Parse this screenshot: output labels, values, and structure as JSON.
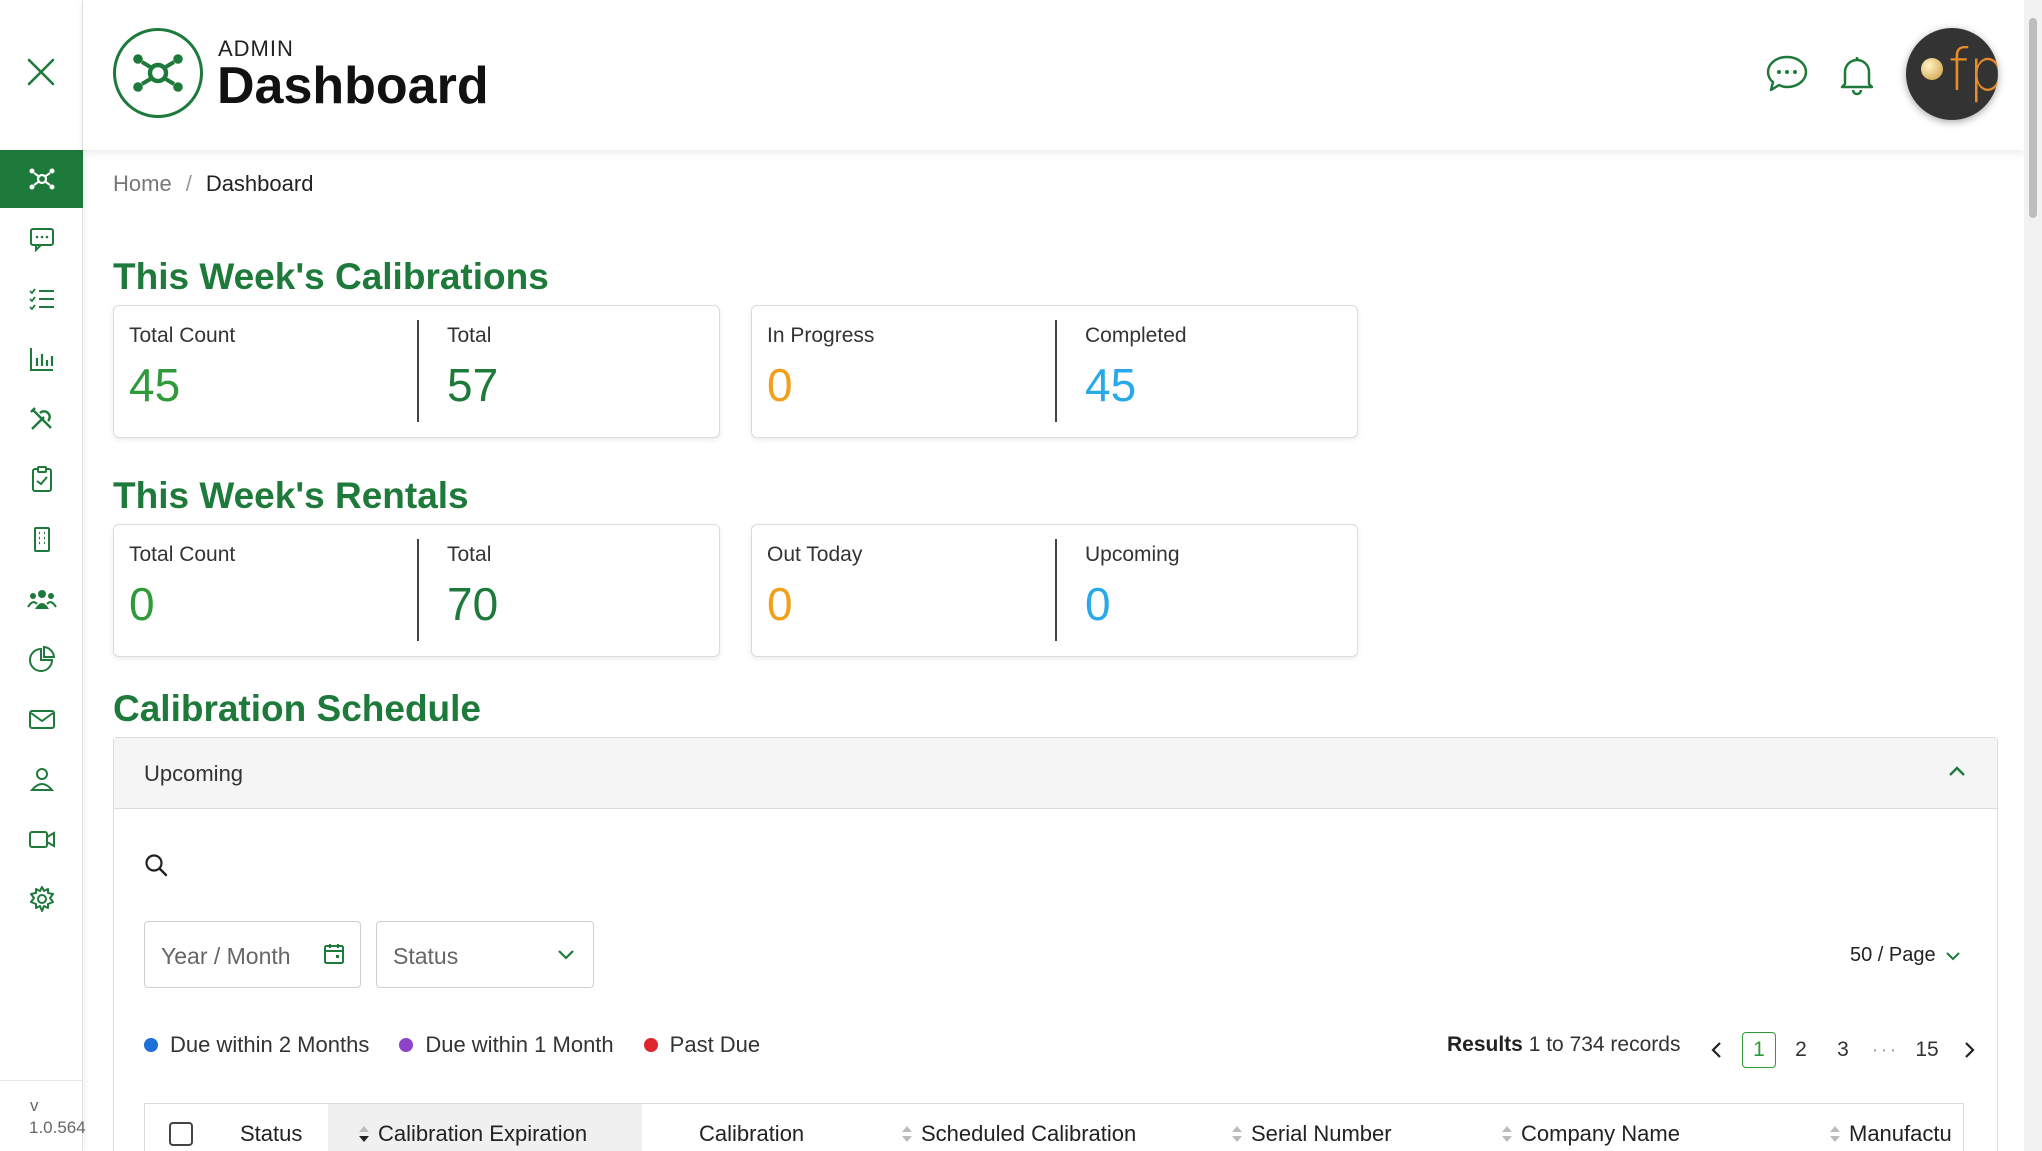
{
  "sidebar": {
    "items": [
      {
        "name": "sidebar-item-dashboard",
        "icon": "network-icon",
        "active": true
      },
      {
        "name": "sidebar-item-messages",
        "icon": "chat-icon"
      },
      {
        "name": "sidebar-item-tasks",
        "icon": "checklist-icon"
      },
      {
        "name": "sidebar-item-reports",
        "icon": "bar-chart-icon"
      },
      {
        "name": "sidebar-item-tools",
        "icon": "tools-icon"
      },
      {
        "name": "sidebar-item-clipboard",
        "icon": "clipboard-check-icon"
      },
      {
        "name": "sidebar-item-building",
        "icon": "building-icon"
      },
      {
        "name": "sidebar-item-users",
        "icon": "users-icon"
      },
      {
        "name": "sidebar-item-analytics",
        "icon": "pie-chart-icon"
      },
      {
        "name": "sidebar-item-mail",
        "icon": "mail-icon"
      },
      {
        "name": "sidebar-item-profile",
        "icon": "user-pin-icon"
      },
      {
        "name": "sidebar-item-video",
        "icon": "video-icon"
      },
      {
        "name": "sidebar-item-settings",
        "icon": "gear-icon"
      }
    ],
    "version_prefix": "v",
    "version": "1.0.564"
  },
  "header": {
    "admin_label": "ADMIN",
    "title": "Dashboard",
    "avatar_text": "fp"
  },
  "breadcrumb": {
    "home": "Home",
    "separator": "/",
    "current": "Dashboard"
  },
  "calibrations": {
    "title": "This Week's Calibrations",
    "card1": {
      "label1": "Total Count",
      "value1": "45",
      "label2": "Total",
      "value2": "57"
    },
    "card2": {
      "label1": "In Progress",
      "value1": "0",
      "label2": "Completed",
      "value2": "45"
    }
  },
  "rentals": {
    "title": "This Week's Rentals",
    "card1": {
      "label1": "Total Count",
      "value1": "0",
      "label2": "Total",
      "value2": "70"
    },
    "card2": {
      "label1": "Out Today",
      "value1": "0",
      "label2": "Upcoming",
      "value2": "0"
    }
  },
  "schedule": {
    "title": "Calibration Schedule",
    "panel_title": "Upcoming",
    "date_placeholder": "Year / Month",
    "status_placeholder": "Status",
    "per_page": "50 / Page",
    "legend": [
      {
        "label": "Due within 2 Months",
        "color": "#1e6fd9"
      },
      {
        "label": "Due within 1 Month",
        "color": "#8e44c9"
      },
      {
        "label": "Past Due",
        "color": "#e0242b"
      }
    ],
    "results_bold": "Results",
    "results_text": "1 to 734 records",
    "pages": [
      "1",
      "2",
      "3",
      "···",
      "15"
    ],
    "columns": [
      "Status",
      "Calibration Expiration",
      "Calibration",
      "Scheduled Calibration",
      "Serial Number",
      "Company Name",
      "Manufactu"
    ]
  },
  "colors": {
    "brand_green": "#1e7a3a",
    "value_green": "#2e9a3a",
    "value_orange": "#f2a01c",
    "value_blue": "#2aa9ea"
  }
}
